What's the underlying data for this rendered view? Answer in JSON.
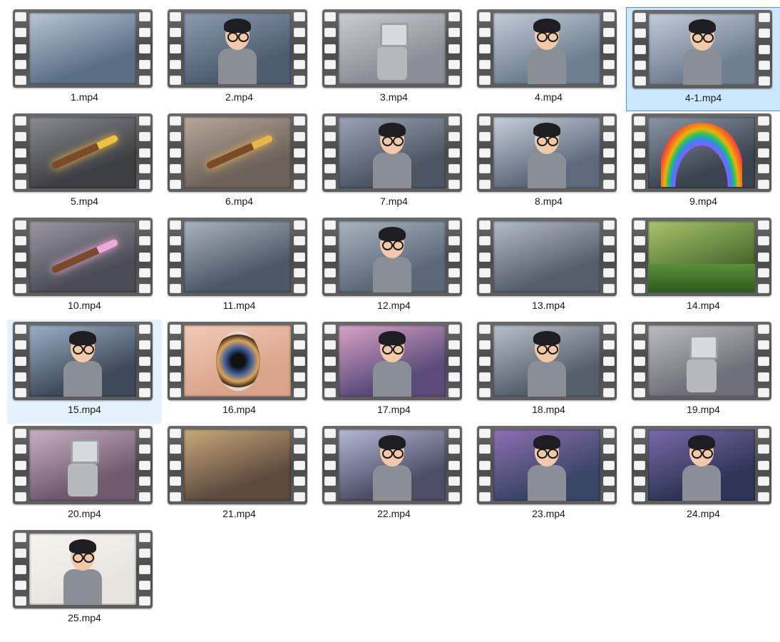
{
  "files": [
    {
      "name": "1.mp4",
      "thumb": "office-empty-desks",
      "c1": "#5a6f86",
      "c2": "#b9c6d4",
      "accent": "#7fa6c9"
    },
    {
      "name": "2.mp4",
      "thumb": "boy-glasses-paper-stacks",
      "c1": "#4e5d70",
      "c2": "#8d9bb0",
      "accent": "#2b2b2b"
    },
    {
      "name": "3.mp4",
      "thumb": "robot-in-cubicle",
      "c1": "#8b8f95",
      "c2": "#c9ccd1",
      "accent": "#dfe3e8"
    },
    {
      "name": "4.mp4",
      "thumb": "boy-at-desk",
      "c1": "#6f7f92",
      "c2": "#c2ccd7",
      "accent": "#2b2b2b"
    },
    {
      "name": "4-1.mp4",
      "thumb": "boy-at-desk",
      "c1": "#6f7f92",
      "c2": "#c2ccd7",
      "accent": "#2b2b2b"
    },
    {
      "name": "5.mp4",
      "thumb": "glowing-paintbrush",
      "c1": "#3d3f44",
      "c2": "#8a8c92",
      "accent": "#f0c040"
    },
    {
      "name": "6.mp4",
      "thumb": "hand-grabs-brush",
      "c1": "#6c625a",
      "c2": "#b7a899",
      "accent": "#e8b64a"
    },
    {
      "name": "7.mp4",
      "thumb": "boy-surprised-closeup",
      "c1": "#4b5564",
      "c2": "#9aa4b2",
      "accent": "#2b2b2b"
    },
    {
      "name": "8.mp4",
      "thumb": "boy-holding-magic-brush",
      "c1": "#5d6a7c",
      "c2": "#c7cfd9",
      "accent": "#f5c24a"
    },
    {
      "name": "9.mp4",
      "thumb": "rainbow-over-office",
      "c1": "#3a4350",
      "c2": "#8b96a4",
      "accent": "#e94f4f"
    },
    {
      "name": "10.mp4",
      "thumb": "brush-butterflies",
      "c1": "#4a4d55",
      "c2": "#9d98a2",
      "accent": "#f0a8d8"
    },
    {
      "name": "11.mp4",
      "thumb": "iridescent-desk",
      "c1": "#4d5866",
      "c2": "#aab4c0",
      "accent": "#c9e6f5"
    },
    {
      "name": "12.mp4",
      "thumb": "boy-touches-jelly-desk",
      "c1": "#5c6878",
      "c2": "#aab4c0",
      "accent": "#f07b8e"
    },
    {
      "name": "13.mp4",
      "thumb": "crystal-butterflies-office",
      "c1": "#555e6b",
      "c2": "#b3bcc7",
      "accent": "#e6f2ff"
    },
    {
      "name": "14.mp4",
      "thumb": "flower-meadow",
      "c1": "#4a6b2e",
      "c2": "#a9c46a",
      "accent": "#f5d36b"
    },
    {
      "name": "15.mp4",
      "thumb": "boy-smiling-closeup",
      "c1": "#3e4a5a",
      "c2": "#9ab0c6",
      "accent": "#2b2b2b"
    },
    {
      "name": "16.mp4",
      "thumb": "eye-closeup",
      "c1": "#d9a48a",
      "c2": "#f2cbb6",
      "accent": "#2a3a66"
    },
    {
      "name": "17.mp4",
      "thumb": "boy-laughing-light",
      "c1": "#5b4b7a",
      "c2": "#d8a3c6",
      "accent": "#f2c79e"
    },
    {
      "name": "18.mp4",
      "thumb": "boy-running-office-grass",
      "c1": "#56606d",
      "c2": "#b7c0ca",
      "accent": "#4f8a3a"
    },
    {
      "name": "19.mp4",
      "thumb": "robot-smiling",
      "c1": "#6e7278",
      "c2": "#b9bdc2",
      "accent": "#d9dde2"
    },
    {
      "name": "20.mp4",
      "thumb": "robot-colorful-office",
      "c1": "#6f5a6e",
      "c2": "#c9b1c2",
      "accent": "#f0b46a"
    },
    {
      "name": "21.mp4",
      "thumb": "colorful-cubicles-aerial",
      "c1": "#5e4b3f",
      "c2": "#caa97a",
      "accent": "#6ec8f0"
    },
    {
      "name": "22.mp4",
      "thumb": "boy-magic-swirl",
      "c1": "#4c4e66",
      "c2": "#b6b9d6",
      "accent": "#f5cf7a"
    },
    {
      "name": "23.mp4",
      "thumb": "boy-painting-ceiling",
      "c1": "#3a4666",
      "c2": "#8f6fb3",
      "accent": "#f2b46a"
    },
    {
      "name": "24.mp4",
      "thumb": "boy-in-night-garden",
      "c1": "#2e3556",
      "c2": "#7a6aa8",
      "accent": "#f27b9a"
    },
    {
      "name": "25.mp4",
      "thumb": "boy-waving",
      "c1": "#e9e4df",
      "c2": "#f7f3ef",
      "accent": "#2b2b2b"
    }
  ],
  "selected": "4-1.mp4",
  "hovered": "15.mp4"
}
